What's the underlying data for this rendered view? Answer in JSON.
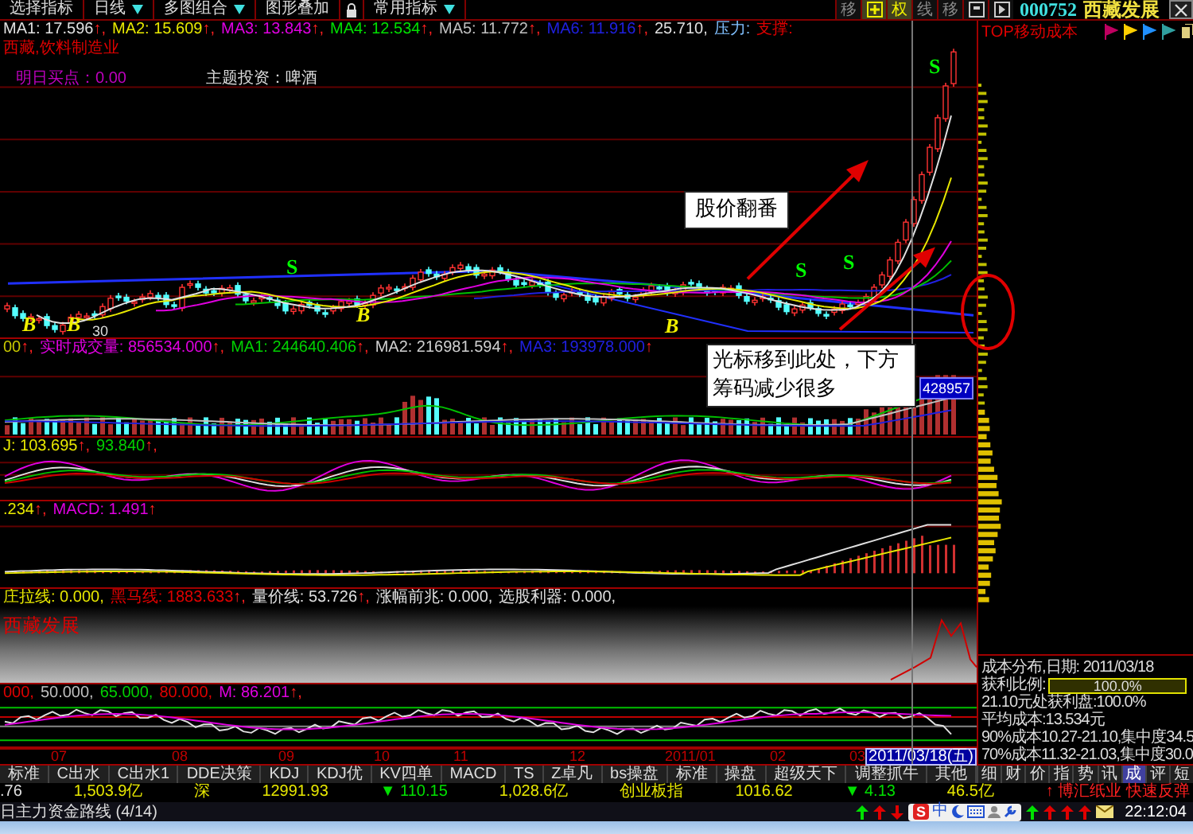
{
  "toolbar": {
    "buttons": [
      {
        "kind": "button",
        "label": "选择指标",
        "dropdown": false
      },
      {
        "kind": "button",
        "label": "日线",
        "dropdown": true
      },
      {
        "kind": "button",
        "label": "多图组合",
        "dropdown": true
      },
      {
        "kind": "button",
        "label": "图形叠加",
        "dropdown": false
      },
      {
        "kind": "lock"
      },
      {
        "kind": "button",
        "label": "常用指标",
        "dropdown": true
      }
    ],
    "right_buttons": [
      {
        "kind": "text",
        "label": "移",
        "selected": false
      },
      {
        "kind": "plus",
        "selected": true
      },
      {
        "kind": "text",
        "label": "权",
        "selected": true
      },
      {
        "kind": "text",
        "label": "线",
        "selected": false
      },
      {
        "kind": "text",
        "label": "移",
        "selected": false
      },
      {
        "kind": "window",
        "selected": false
      },
      {
        "kind": "play",
        "selected": false
      }
    ],
    "code": "000752",
    "name": "西藏发展"
  },
  "price_pane": {
    "legend": [
      {
        "text": "MA1: 17.596",
        "color": "#e0e0e0",
        "suffix": "↑,"
      },
      {
        "text": "MA2: 15.609",
        "color": "#e8e800",
        "suffix": "↑,"
      },
      {
        "text": "MA3: 13.843",
        "color": "#e000e0",
        "suffix": "↑,"
      },
      {
        "text": "MA4: 12.534",
        "color": "#00e000",
        "suffix": "↑,"
      },
      {
        "text": "MA5: 11.772",
        "color": "#c0c0c0",
        "suffix": "↑,"
      },
      {
        "text": "MA6: 11.916",
        "color": "#2020e0",
        "suffix": "↑,"
      },
      {
        "text": "25.710,",
        "color": "#e0e0e0"
      },
      {
        "text": "压力:",
        "color": "#80c0ff"
      },
      {
        "text": "支撑:",
        "color": "#e00000"
      }
    ],
    "sector": "西藏,饮料制造业",
    "buy_point": "明日买点：0.00",
    "theme": "主题投资：啤酒",
    "low_label": "30",
    "markers": [
      {
        "kind": "buy",
        "text": "B"
      },
      {
        "kind": "buy",
        "text": "B"
      },
      {
        "kind": "sell",
        "text": "S"
      },
      {
        "kind": "buy",
        "text": "B"
      },
      {
        "kind": "buy",
        "text": "B"
      },
      {
        "kind": "sell",
        "text": "S"
      },
      {
        "kind": "sell",
        "text": "S"
      },
      {
        "kind": "sell",
        "text": "S"
      }
    ]
  },
  "annotations": [
    {
      "text": "股价翻番"
    },
    {
      "text": "光标移到此处，下方筹码减少很多"
    }
  ],
  "volume_pane": {
    "legend": [
      {
        "text": "00",
        "color": "#c8c800",
        "suffix": "↑,"
      },
      {
        "text": "实时成交量: 856534.000",
        "color": "#e000e0",
        "suffix": "↑,"
      },
      {
        "text": "MA1: 244640.406",
        "color": "#00d000",
        "suffix": "↑,"
      },
      {
        "text": "MA2: 216981.594",
        "color": "#d0d0d0",
        "suffix": "↑,"
      },
      {
        "text": "MA3: 193978.000",
        "color": "#2020e0",
        "suffix": "↑"
      }
    ],
    "cursor_value": "428957"
  },
  "kdj_pane": {
    "legend": [
      {
        "text": "J: 103.695",
        "color": "#e8e800",
        "suffix": "↑,"
      },
      {
        "text": "93.840",
        "color": "#00d000",
        "suffix": "↑,"
      }
    ]
  },
  "macd_pane": {
    "legend": [
      {
        "text": ".234",
        "color": "#e8e800",
        "suffix": "↑,"
      },
      {
        "text": "MACD: 1.491",
        "color": "#e000e0",
        "suffix": "↑"
      }
    ]
  },
  "signal_pane": {
    "legend": [
      {
        "text": "庄拉线: 0.000,",
        "color": "#e8e800"
      },
      {
        "text": "黑马线: 1883.633",
        "color": "#e00000",
        "suffix": "↑,"
      },
      {
        "text": "量价线: 53.726",
        "color": "#e0e0e0",
        "suffix": "↑,"
      },
      {
        "text": "涨幅前兆: 0.000,",
        "color": "#e0e0e0"
      },
      {
        "text": "选股利器: 0.000,",
        "color": "#e0e0e0"
      }
    ],
    "title": "西藏发展"
  },
  "osc_pane": {
    "legend": [
      {
        "text": "000,",
        "color": "#e00000"
      },
      {
        "text": "50.000,",
        "color": "#c0c0c0"
      },
      {
        "text": "65.000,",
        "color": "#00d000"
      },
      {
        "text": "80.000,",
        "color": "#e00000"
      },
      {
        "text": "M: 86.201",
        "color": "#e000e0",
        "suffix": "↑,"
      }
    ]
  },
  "date_axis": {
    "labels": [
      "07",
      "08",
      "09",
      "10",
      "11",
      "12",
      "2011/01",
      "02",
      "03"
    ],
    "cursor_date": "2011/03/18(五)"
  },
  "cost_panel": {
    "title": "TOP移动成本",
    "date_line": "成本分布,日期: 2011/03/18",
    "profit_label": "获利比例:",
    "profit": {
      "reading": "100.0%",
      "level": 1
    },
    "lines": [
      "21.10元处获利盘:100.0%",
      "平均成本:13.534元",
      "90%成本10.27-21.10,集中度34.5",
      "70%成本11.32-21.03,集中度30.0"
    ]
  },
  "tabs": [
    {
      "label": "标准",
      "selected": false
    },
    {
      "label": "C出水",
      "selected": false
    },
    {
      "label": "C出水1",
      "selected": false
    },
    {
      "label": "DDE决策",
      "selected": false
    },
    {
      "label": "KDJ",
      "selected": false
    },
    {
      "label": "KDJ优",
      "selected": false
    },
    {
      "label": "KV四单",
      "selected": false
    },
    {
      "label": "MACD",
      "selected": false
    },
    {
      "label": "TS",
      "selected": false
    },
    {
      "label": "Z卓凡",
      "selected": false
    },
    {
      "label": "bs操盘",
      "selected": false
    },
    {
      "label": "标准",
      "selected": false
    },
    {
      "label": "操盘",
      "selected": false
    },
    {
      "label": "超级天下",
      "selected": false
    },
    {
      "label": "调整抓牛",
      "selected": false
    },
    {
      "label": "其他",
      "selected": false
    }
  ],
  "side_tabs": [
    {
      "label": "细",
      "selected": false
    },
    {
      "label": "财",
      "selected": false
    },
    {
      "label": "价",
      "selected": false
    },
    {
      "label": "指",
      "selected": false
    },
    {
      "label": "势",
      "selected": false
    },
    {
      "label": "讯",
      "selected": false
    },
    {
      "label": "成",
      "selected": true
    },
    {
      "label": "评",
      "selected": false
    },
    {
      "label": "短",
      "selected": false
    }
  ],
  "status": [
    {
      "text": ".76",
      "color": "#e0e0e0"
    },
    {
      "text": "1,503.9亿",
      "color": "#e8e800"
    },
    {
      "text": "深",
      "color": "#e8e800"
    },
    {
      "text": "12991.93",
      "color": "#e8e800"
    },
    {
      "text": "▼ 110.15",
      "color": "#00e000"
    },
    {
      "text": "1,028.6亿",
      "color": "#e8e800"
    },
    {
      "text": "创业板指",
      "color": "#e8e800"
    },
    {
      "text": "1016.62",
      "color": "#e8e800"
    },
    {
      "text": "▼ 4.13",
      "color": "#00e000"
    },
    {
      "text": "46.5亿",
      "color": "#e8e800"
    },
    {
      "text": "↑ 博汇纸业 快速反弹",
      "color": "#ff2020"
    }
  ],
  "footer": {
    "title": "日主力资金路线 (4/14)",
    "ime": {
      "logo": "S",
      "mode": "中"
    },
    "time": "22:12:04"
  }
}
